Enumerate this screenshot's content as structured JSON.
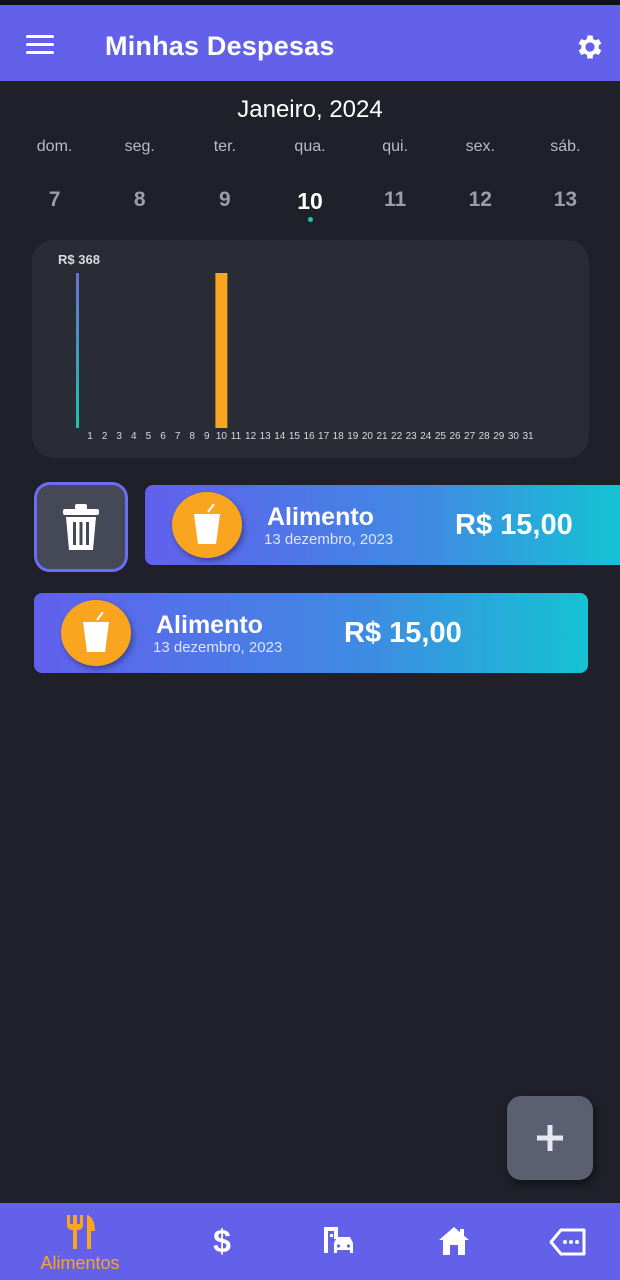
{
  "header": {
    "title": "Minhas Despesas",
    "menu_icon": "menu-icon",
    "settings_icon": "gear-icon"
  },
  "calendar": {
    "month_label": "Janeiro, 2024",
    "weekdays": [
      "dom.",
      "seg.",
      "ter.",
      "qua.",
      "qui.",
      "sex.",
      "sáb."
    ],
    "days": [
      "7",
      "8",
      "9",
      "10",
      "11",
      "12",
      "13"
    ],
    "selected_day": "10",
    "accent": "#18c7a9"
  },
  "chart_data": {
    "type": "bar",
    "y_max_label": "R$ 368",
    "ylim": [
      0,
      368
    ],
    "categories": [
      "1",
      "2",
      "3",
      "4",
      "5",
      "6",
      "7",
      "8",
      "9",
      "10",
      "11",
      "12",
      "13",
      "14",
      "15",
      "16",
      "17",
      "18",
      "19",
      "20",
      "21",
      "22",
      "23",
      "24",
      "25",
      "26",
      "27",
      "28",
      "29",
      "30",
      "31"
    ],
    "values": [
      0,
      0,
      0,
      0,
      0,
      0,
      0,
      0,
      0,
      368,
      0,
      0,
      0,
      0,
      0,
      0,
      0,
      0,
      0,
      0,
      0,
      0,
      0,
      0,
      0,
      0,
      0,
      0,
      0,
      0,
      0
    ],
    "highlight_day": "10",
    "bar_color": "#f9a51f",
    "axis_color": "#6b6fd6",
    "grid": false
  },
  "actions": {
    "delete_icon": "trash-icon",
    "add_icon": "plus-icon"
  },
  "expenses": [
    {
      "category": "Alimento",
      "date": "13 dezembro, 2023",
      "amount": "R$ 15,00",
      "icon": "cup-icon"
    },
    {
      "category": "Alimento",
      "date": "13 dezembro, 2023",
      "amount": "R$ 15,00",
      "icon": "cup-icon"
    }
  ],
  "bottom_nav": {
    "items": [
      {
        "label": "Alimentos",
        "icon": "fork-knife-icon",
        "active": true
      },
      {
        "label": "",
        "icon": "dollar-icon",
        "active": false
      },
      {
        "label": "",
        "icon": "car-building-icon",
        "active": false
      },
      {
        "label": "",
        "icon": "home-icon",
        "active": false
      },
      {
        "label": "",
        "icon": "tag-icon",
        "active": false
      }
    ],
    "active_color": "#f9a51f"
  },
  "colors": {
    "primary": "#6361ea",
    "background": "#1f2029",
    "card": "#2a2c35",
    "accent_orange": "#f9a51f"
  }
}
